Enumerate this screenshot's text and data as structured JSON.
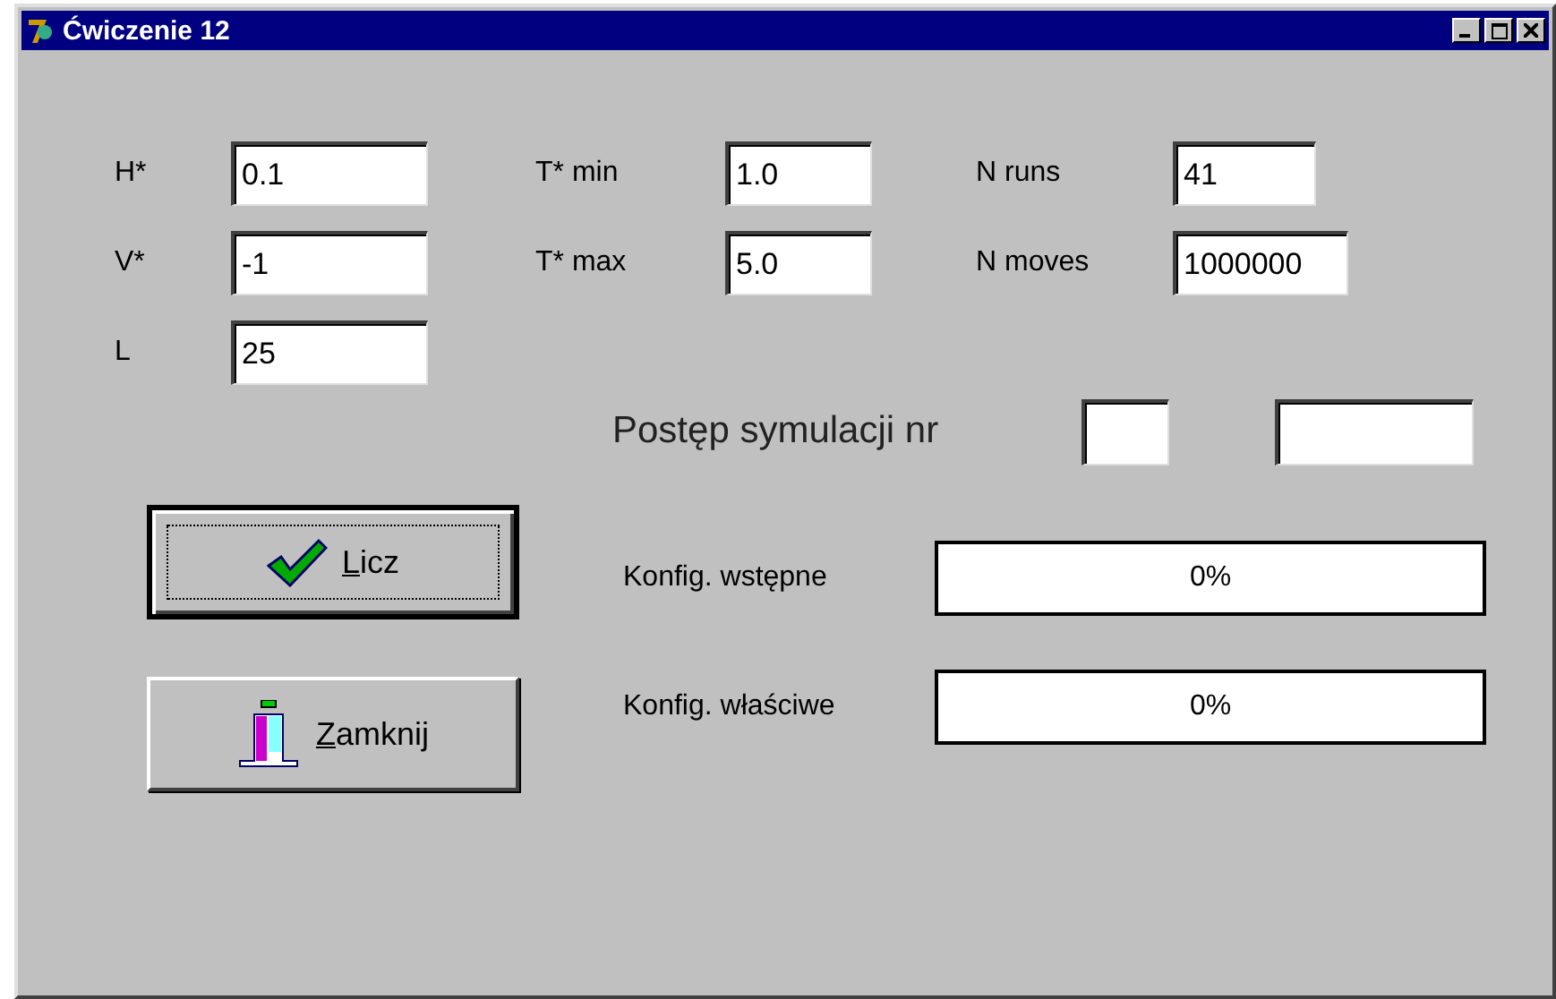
{
  "window": {
    "title": "Ćwiczenie 12"
  },
  "parameters": [
    {
      "label": "H*",
      "value": "0.1"
    },
    {
      "label": "V*",
      "value": "-1"
    },
    {
      "label": "L",
      "value": "25"
    },
    {
      "label": "T* min",
      "value": "1.0"
    },
    {
      "label": "T* max",
      "value": "5.0"
    },
    {
      "label": "N runs",
      "value": "41"
    },
    {
      "label": "N moves",
      "value": "1000000"
    }
  ],
  "progress_header": {
    "label": "Postęp symulacji nr"
  },
  "buttons": [
    {
      "label": "Licz",
      "kind": "check",
      "focused": true
    },
    {
      "label": "Zamknij",
      "kind": "door",
      "focused": false
    }
  ],
  "progress": [
    {
      "label": "Konfig. wstępne",
      "level": 0,
      "reading": "0%"
    },
    {
      "label": "Konfig. właściwe",
      "level": 0,
      "reading": "0%"
    }
  ]
}
